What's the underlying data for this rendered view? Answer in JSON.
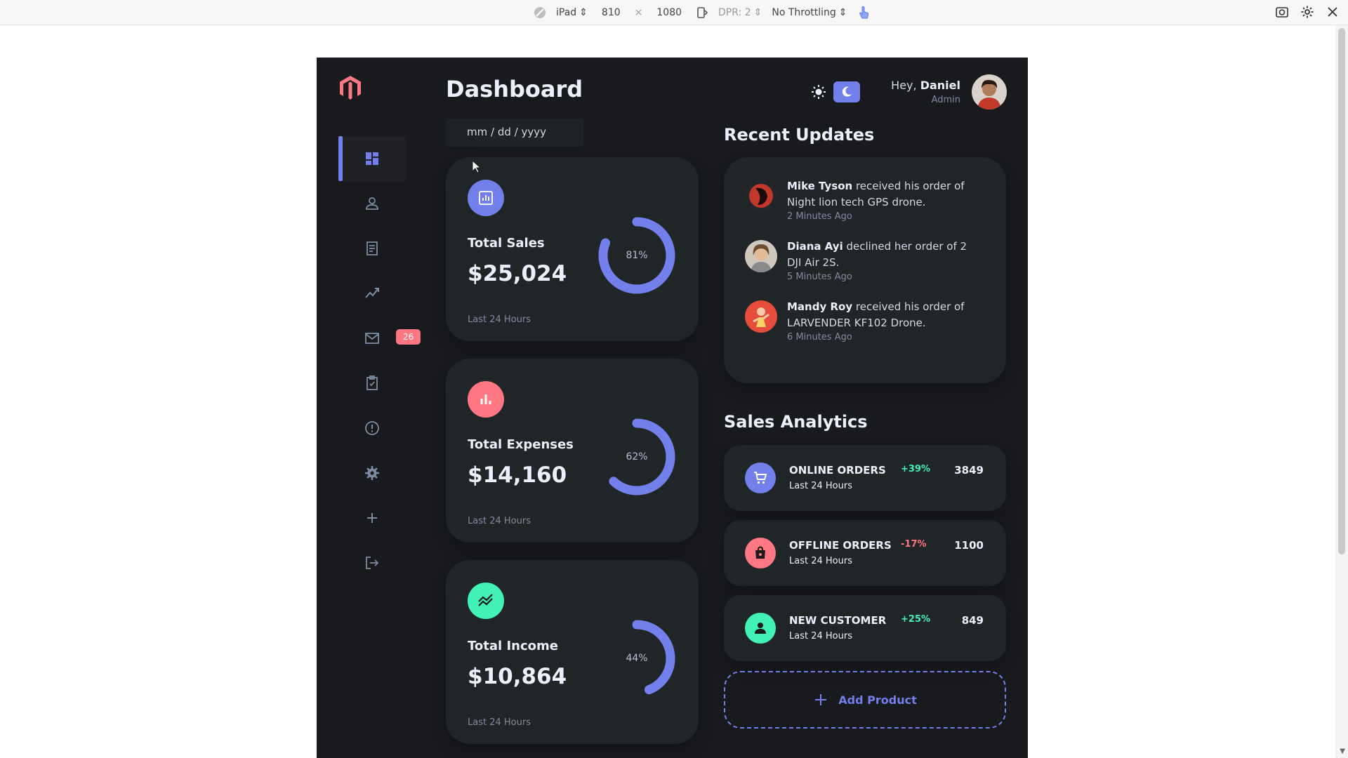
{
  "devtools": {
    "device": "iPad",
    "width": "810",
    "times": "×",
    "height": "1080",
    "dpr": "DPR: 2",
    "throttling": "No Throttling"
  },
  "app": {
    "page_title": "Dashboard",
    "date_placeholder": "mm / dd / yyyy",
    "user": {
      "greeting": "Hey,",
      "name": "Daniel",
      "role": "Admin"
    },
    "sidebar": {
      "items": [
        {
          "icon": "grid-icon",
          "active": true
        },
        {
          "icon": "person-icon"
        },
        {
          "icon": "receipt-icon"
        },
        {
          "icon": "insights-icon"
        },
        {
          "icon": "mail-icon",
          "badge": "26"
        },
        {
          "icon": "inventory-icon"
        },
        {
          "icon": "report-icon"
        },
        {
          "icon": "settings-icon"
        },
        {
          "icon": "add-icon"
        },
        {
          "icon": "logout-icon"
        }
      ]
    },
    "cards": [
      {
        "label": "Total Sales",
        "amount": "$25,024",
        "percent": "81%",
        "progress": 0.81,
        "meta": "Last 24 Hours",
        "color": "#7380ec"
      },
      {
        "label": "Total Expenses",
        "amount": "$14,160",
        "percent": "62%",
        "progress": 0.62,
        "meta": "Last 24 Hours",
        "color": "#ff7782"
      },
      {
        "label": "Total Income",
        "amount": "$10,864",
        "percent": "44%",
        "progress": 0.44,
        "meta": "Last 24 Hours",
        "color": "#41f1b6"
      }
    ],
    "recent_updates": {
      "title": "Recent Updates",
      "items": [
        {
          "name": "Mike Tyson",
          "text": " received his order of Night lion tech GPS drone.",
          "time": "2 Minutes Ago"
        },
        {
          "name": "Diana Ayi",
          "text": " declined her order of 2 DJI Air 2S.",
          "time": "5 Minutes Ago"
        },
        {
          "name": "Mandy Roy",
          "text": " received his order of LARVENDER KF102 Drone.",
          "time": "6 Minutes Ago"
        }
      ]
    },
    "sales_analytics": {
      "title": "Sales Analytics",
      "items": [
        {
          "title": "ONLINE ORDERS",
          "sub": "Last 24 Hours",
          "pct": "+39%",
          "value": "3849",
          "color": "#7380ec",
          "pct_color": "#41f1b6"
        },
        {
          "title": "OFFLINE ORDERS",
          "sub": "Last 24 Hours",
          "pct": "-17%",
          "value": "1100",
          "color": "#ff7782",
          "pct_color": "#ff7782"
        },
        {
          "title": "NEW CUSTOMER",
          "sub": "Last 24 Hours",
          "pct": "+25%",
          "value": "849",
          "color": "#41f1b6",
          "pct_color": "#41f1b6"
        }
      ]
    },
    "add_product": "Add Product"
  }
}
